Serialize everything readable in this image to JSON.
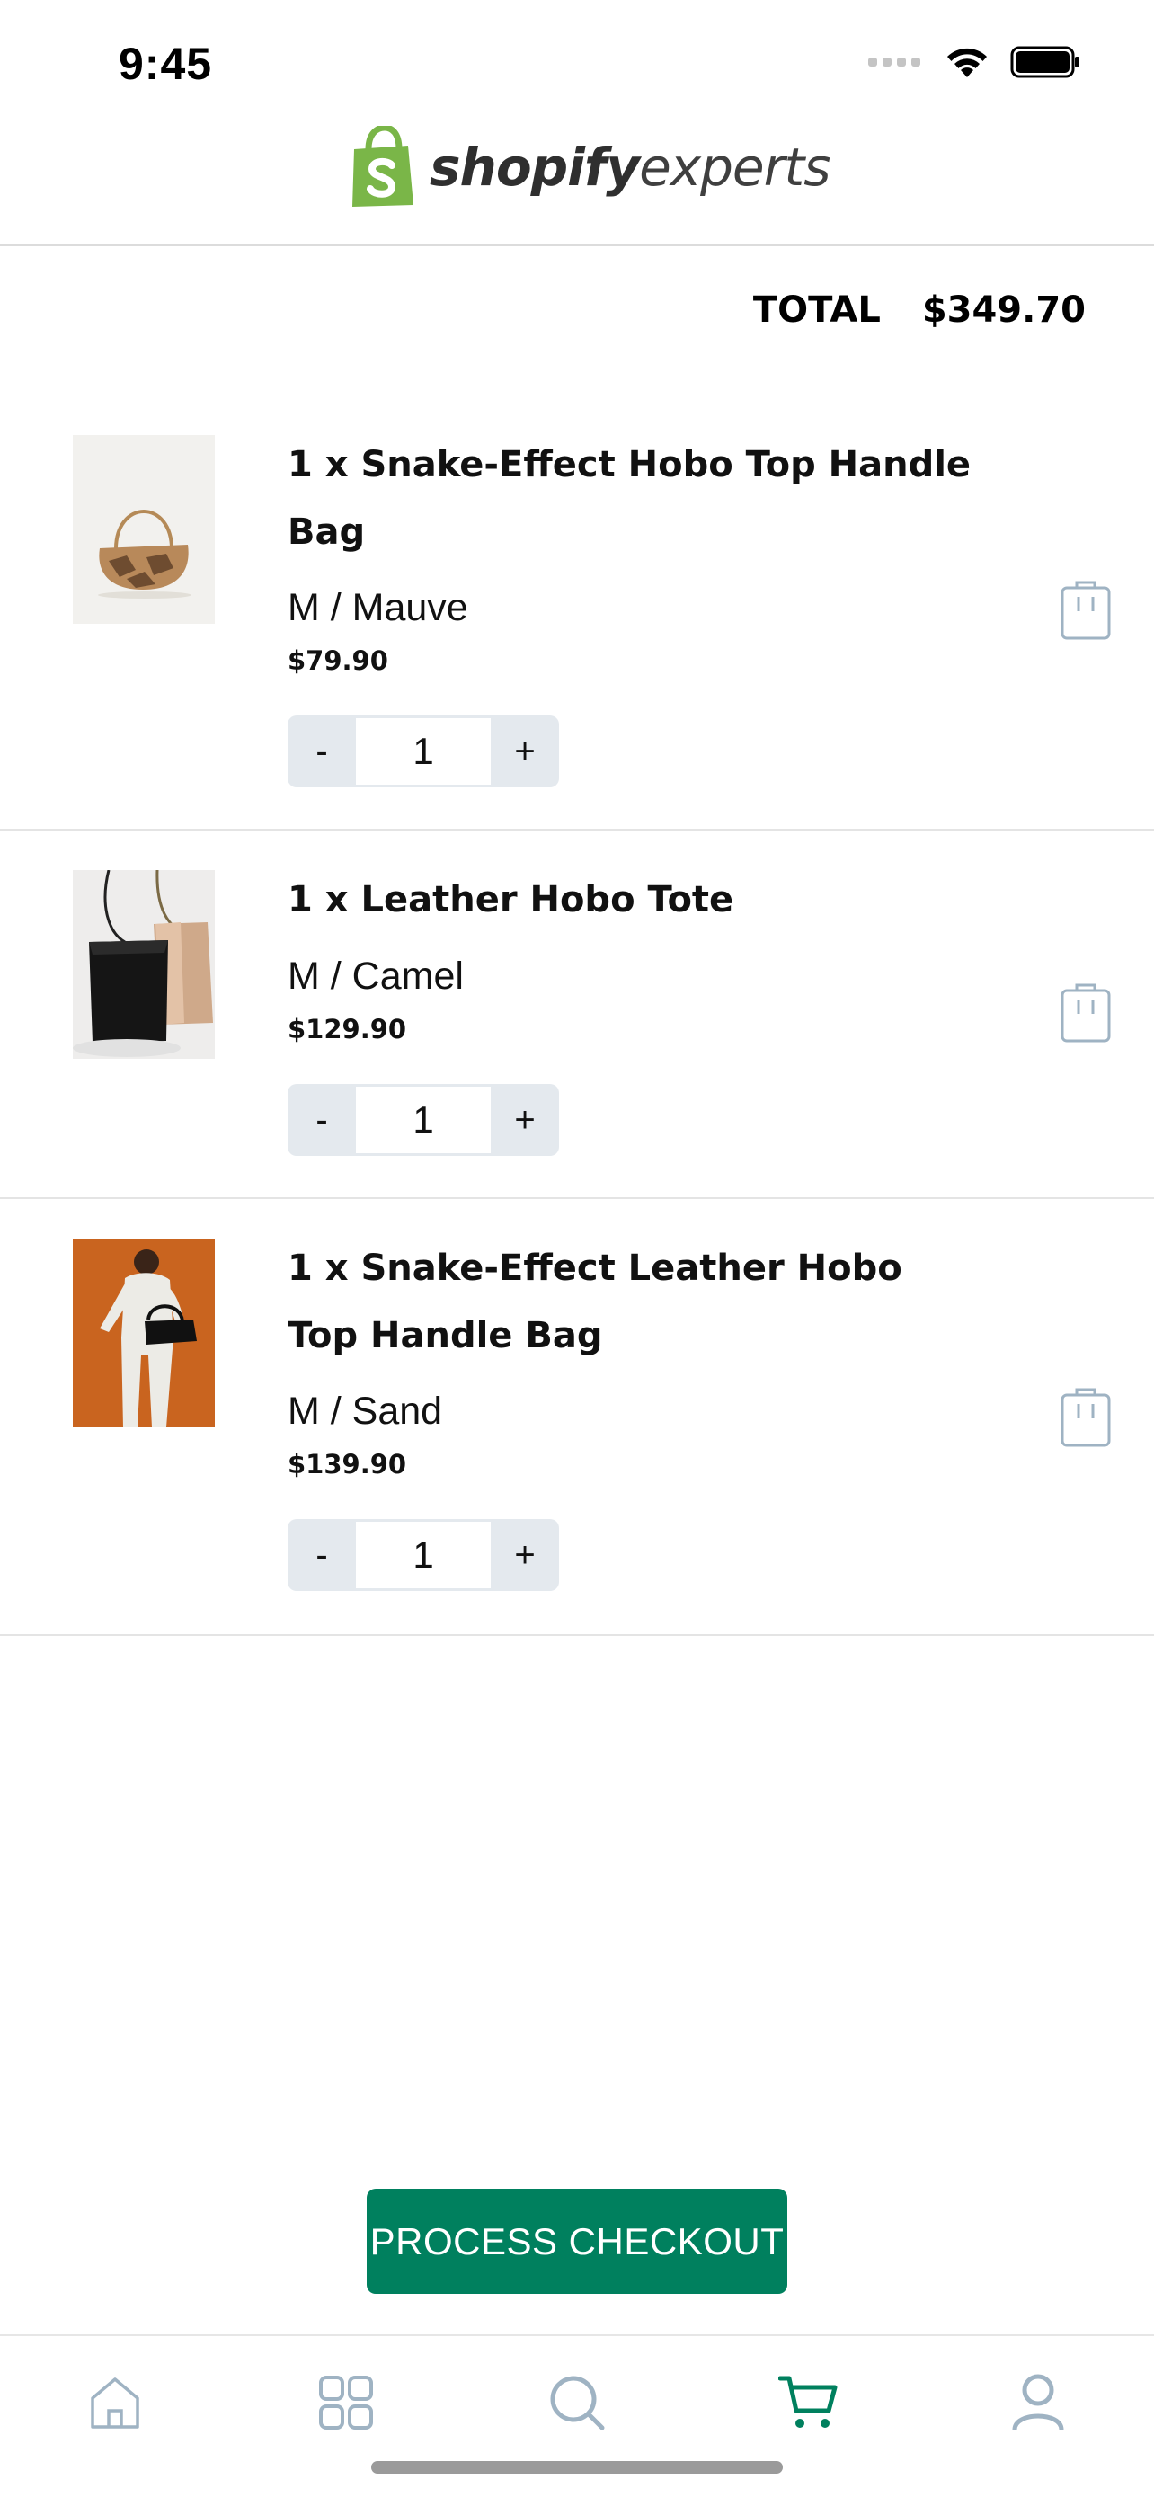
{
  "status_bar": {
    "time": "9:45"
  },
  "brand": {
    "name_bold": "shopify",
    "name_light": "experts",
    "logo_color": "#7ab648"
  },
  "cart": {
    "total_label": "TOTAL",
    "total_value": "$349.70",
    "items": [
      {
        "title": "1 x Snake-Effect Hobo Top Handle Bag",
        "variant": "M / Mauve",
        "price": "$79.90",
        "quantity": "1",
        "minus": "-",
        "plus": "+"
      },
      {
        "title": "1 x Leather Hobo Tote",
        "variant": "M / Camel",
        "price": "$129.90",
        "quantity": "1",
        "minus": "-",
        "plus": "+"
      },
      {
        "title": "1 x Snake-Effect Leather Hobo Top Handle Bag",
        "variant": "M / Sand",
        "price": "$139.90",
        "quantity": "1",
        "minus": "-",
        "plus": "+"
      }
    ]
  },
  "checkout": {
    "label": "PROCESS CHECKOUT",
    "color": "#00805e"
  },
  "tab_bar": {
    "tabs": [
      {
        "icon": "home-icon",
        "active": false
      },
      {
        "icon": "grid-icon",
        "active": false
      },
      {
        "icon": "search-icon",
        "active": false
      },
      {
        "icon": "cart-icon",
        "active": true
      },
      {
        "icon": "user-icon",
        "active": false
      }
    ],
    "active_color": "#00805e",
    "inactive_color": "#9fb3c3"
  }
}
